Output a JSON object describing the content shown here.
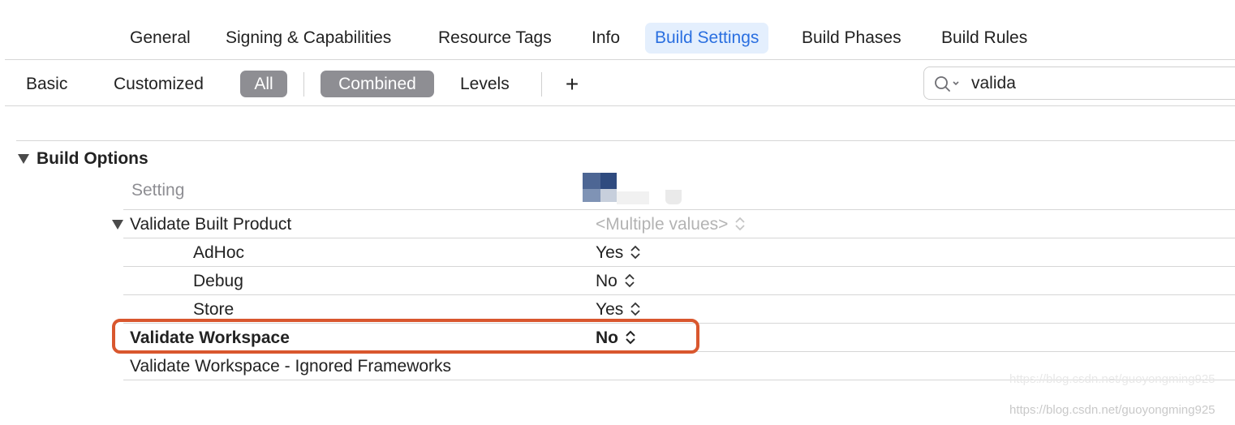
{
  "tabs": [
    {
      "label": "General",
      "active": false
    },
    {
      "label": "Signing & Capabilities",
      "active": false
    },
    {
      "label": "Resource Tags",
      "active": false
    },
    {
      "label": "Info",
      "active": false
    },
    {
      "label": "Build Settings",
      "active": true
    },
    {
      "label": "Build Phases",
      "active": false
    },
    {
      "label": "Build Rules",
      "active": false
    }
  ],
  "filter_bar": {
    "basic": "Basic",
    "customized": "Customized",
    "all": "All",
    "combined": "Combined",
    "levels": "Levels",
    "add": "+",
    "search_value": "valida"
  },
  "section": {
    "title": "Build Options",
    "header": "Setting",
    "rows": [
      {
        "name": "Validate Built Product",
        "value": "<Multiple values>",
        "expanded": true
      },
      {
        "name": "AdHoc",
        "value": "Yes"
      },
      {
        "name": "Debug",
        "value": "No"
      },
      {
        "name": "Store",
        "value": "Yes"
      },
      {
        "name": "Validate Workspace",
        "value": "No",
        "bold": true
      },
      {
        "name": "Validate Workspace - Ignored Frameworks",
        "value": ""
      }
    ]
  },
  "watermark": "https://blog.csdn.net/guoyongming925",
  "colors": {
    "accent": "#2a6fe0",
    "highlight": "#d9572e",
    "pill": "#8e8e93"
  }
}
